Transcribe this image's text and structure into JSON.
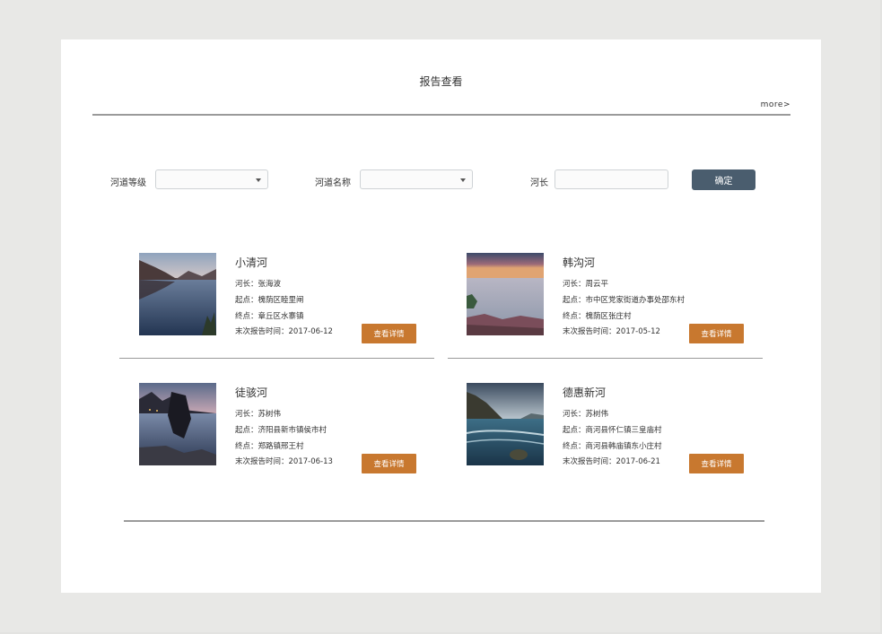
{
  "page": {
    "title": "报告查看",
    "more_label": "more>"
  },
  "filters": {
    "level_label": "河道等级",
    "name_label": "河道名称",
    "chief_label": "河长",
    "level_value": "",
    "name_value": "",
    "chief_value": "",
    "confirm_label": "确定"
  },
  "rivers": [
    {
      "name": "小清河",
      "chief": "河长：张海波",
      "start": "起点：槐荫区睦里闸",
      "end": "终点：章丘区水寨镇",
      "last_report": "末次报告时间：2017-06-12",
      "detail_label": "查看详情",
      "image": "mountain-lake-reflection"
    },
    {
      "name": "韩沟河",
      "chief": "河长：周云平",
      "start": "起点：市中区党家街道办事处邵东村",
      "end": "终点：槐荫区张庄村",
      "last_report": "末次报告时间：2017-05-12",
      "detail_label": "查看详情",
      "image": "sunset-sea-shore"
    },
    {
      "name": "徒骇河",
      "chief": "河长：苏树伟",
      "start": "起点：济阳县新市镇侯市村",
      "end": "终点：郑路镇邢王村",
      "last_report": "末次报告时间：2017-06-13",
      "detail_label": "查看详情",
      "image": "night-rocky-lake"
    },
    {
      "name": "德惠新河",
      "chief": "河长：苏树伟",
      "start": "起点：商河县怀仁镇三皇庙村",
      "end": "终点：商河县韩庙镇东小庄村",
      "last_report": "末次报告时间：2017-06-21",
      "detail_label": "查看详情",
      "image": "cloudy-coast-water"
    }
  ]
}
